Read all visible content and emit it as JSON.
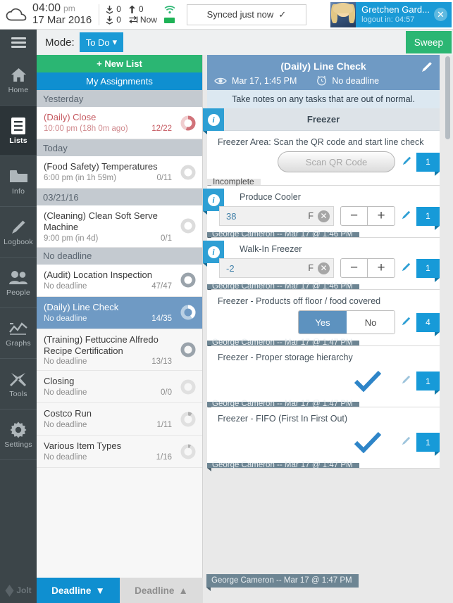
{
  "statusbar": {
    "cloud_icon": "cloud-icon",
    "time": "04:00",
    "ampm": "pm",
    "date": "17 Mar 2016",
    "download_count_1": "0",
    "download_count_2": "0",
    "upload_count": "0",
    "sync_label": "Now",
    "sync_status": "Synced just now",
    "sync_check": "✓",
    "user_name": "Gretchen Gard...",
    "user_logout": "logout in: 04:57",
    "close_label": "✕"
  },
  "modebar": {
    "menu_icon": "hamburger-icon",
    "mode_label": "Mode:",
    "mode_value": "To Do",
    "mode_caret": "▾",
    "sweep_label": "Sweep"
  },
  "sidebar": {
    "items": [
      {
        "label": "Home",
        "icon": "home-icon",
        "active": false
      },
      {
        "label": "Lists",
        "icon": "list-icon",
        "active": true
      },
      {
        "label": "Info",
        "icon": "folder-icon",
        "active": false
      },
      {
        "label": "Logbook",
        "icon": "pencil-icon",
        "active": false
      },
      {
        "label": "People",
        "icon": "people-icon",
        "active": false
      },
      {
        "label": "Graphs",
        "icon": "graph-icon",
        "active": false
      },
      {
        "label": "Tools",
        "icon": "tools-icon",
        "active": false
      },
      {
        "label": "Settings",
        "icon": "gear-icon",
        "active": false
      }
    ]
  },
  "listpanel": {
    "new_list_label": "+ New List",
    "my_assignments_label": "My Assignments",
    "groups": [
      {
        "header": "Yesterday",
        "rows": [
          {
            "title": "(Daily) Close",
            "deadline": "10:00 pm (18h 0m ago)",
            "count": "12/22",
            "state": "overdue",
            "progress": 0.545
          }
        ]
      },
      {
        "header": "Today",
        "rows": [
          {
            "title": "(Food Safety) Temperatures",
            "deadline": "6:00 pm (in 1h 59m)",
            "count": "0/11",
            "state": "normal",
            "progress": 0
          }
        ]
      },
      {
        "header": "03/21/16",
        "rows": [
          {
            "title": "(Cleaning) Clean Soft Serve Machine",
            "deadline": "9:00 pm (in 4d)",
            "count": "0/1",
            "state": "normal",
            "progress": 0
          }
        ]
      },
      {
        "header": "No deadline",
        "rows": [
          {
            "title": "(Audit) Location Inspection",
            "deadline": "No deadline",
            "count": "47/47",
            "state": "done",
            "progress": 1
          },
          {
            "title": "(Daily) Line Check",
            "deadline": "No deadline",
            "count": "14/35",
            "state": "selected",
            "progress": 0.4
          },
          {
            "title": "(Training) Fettuccine Alfredo Recipe Certification",
            "deadline": "No deadline",
            "count": "13/13",
            "state": "done",
            "progress": 1
          },
          {
            "title": "Closing",
            "deadline": "No deadline",
            "count": "0/0",
            "state": "normal",
            "progress": 0
          },
          {
            "title": "Costco Run",
            "deadline": "No deadline",
            "count": "1/11",
            "state": "normal",
            "progress": 0.09
          },
          {
            "title": "Various Item Types",
            "deadline": "No deadline",
            "count": "1/16",
            "state": "normal",
            "progress": 0.0625
          }
        ]
      }
    ]
  },
  "detail": {
    "title": "(Daily) Line Check",
    "eye_icon": "eye-icon",
    "date": "Mar 17, 1:45 PM",
    "alarm_icon": "alarm-icon",
    "deadline": "No deadline",
    "edit_icon": "pencil-icon",
    "note": "Take notes on any tasks that are out of normal.",
    "section": "Freezer",
    "info_glyph": "i",
    "tasks": [
      {
        "label": "Freezer Area: Scan the QR code and start line check",
        "control": "scan",
        "button_label": "Scan QR Code",
        "badge": "1",
        "status_chip": "Incomplete",
        "signature": ""
      },
      {
        "label": "Produce Cooler",
        "control": "number",
        "value": "38",
        "unit": "F",
        "minus": "−",
        "plus": "+",
        "badge": "1",
        "signature": "George  Cameron -- Mar 17 @ 1:46 PM"
      },
      {
        "label": "Walk-In Freezer",
        "control": "number",
        "value": "-2",
        "unit": "F",
        "minus": "−",
        "plus": "+",
        "badge": "1",
        "signature": "George  Cameron -- Mar 17 @ 1:46 PM"
      },
      {
        "label": "Freezer - Products off floor / food covered",
        "control": "yesno",
        "yes_label": "Yes",
        "no_label": "No",
        "selected": "Yes",
        "badge": "4",
        "signature": "George  Cameron -- Mar 17 @ 1:47 PM"
      },
      {
        "label": "Freezer - Proper storage hierarchy",
        "control": "check",
        "badge": "1",
        "signature": "George  Cameron -- Mar 17 @ 1:47 PM"
      },
      {
        "label": "Freezer - FIFO (First In First Out)",
        "control": "check",
        "badge": "1",
        "signature": "George  Cameron -- Mar 17 @ 1:47 PM"
      }
    ]
  },
  "bottombar": {
    "brand": "Jolt",
    "sort_desc": "Deadline",
    "sort_desc_caret": "▼",
    "sort_asc": "Deadline",
    "sort_asc_caret": "▲"
  },
  "colors": {
    "accent_blue": "#179ad8",
    "green": "#2bb673",
    "selected_blue": "#6f9ac4",
    "dark_nav": "#3c4549",
    "overdue_red": "#c5585f"
  }
}
